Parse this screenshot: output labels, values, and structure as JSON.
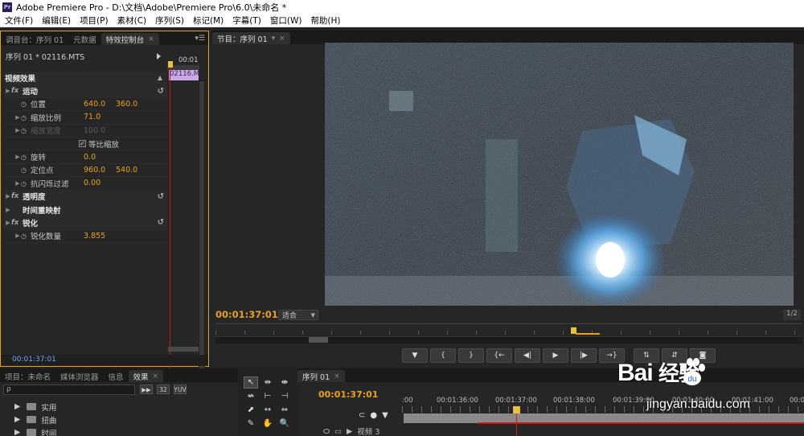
{
  "window": {
    "logo": "Pr",
    "title": "Adobe Premiere Pro - D:\\文档\\Adobe\\Premiere Pro\\6.0\\未命名 *"
  },
  "menu": [
    "文件(F)",
    "编辑(E)",
    "项目(P)",
    "素材(C)",
    "序列(S)",
    "标记(M)",
    "字幕(T)",
    "窗口(W)",
    "帮助(H)"
  ],
  "effect_controls": {
    "tabs": [
      {
        "label": "调音台：序列 01"
      },
      {
        "label": "元数据"
      },
      {
        "label": "特效控制台",
        "active": true
      }
    ],
    "sequence_label": "序列 01 * 02116.MTS",
    "timecode_top": "00:01",
    "clip_label": "02116.MTS",
    "section_title": "视频效果",
    "rows": [
      {
        "type": "section",
        "label": "运动",
        "fx": "fx",
        "reset": "↺"
      },
      {
        "label": "位置",
        "v1": "640.0",
        "v2": "360.0"
      },
      {
        "label": "缩放比例",
        "v1": "71.0",
        "tri": "▶"
      },
      {
        "label": "缩放宽度",
        "v1": "100.0",
        "dim": true,
        "tri": "▶"
      },
      {
        "label": "等比缩放",
        "checkbox": true
      },
      {
        "label": "旋转",
        "v1": "0.0",
        "tri": "▶"
      },
      {
        "label": "定位点",
        "v1": "960.0",
        "v2": "540.0"
      },
      {
        "label": "抗闪烁过滤",
        "v1": "0.00",
        "tri": "▶"
      },
      {
        "type": "section",
        "label": "透明度",
        "fx": "fx",
        "reset": "↺"
      },
      {
        "type": "section",
        "label": "时间重映射",
        "fx": ""
      },
      {
        "type": "section",
        "label": "锐化",
        "fx": "fx",
        "reset": "↺"
      },
      {
        "label": "锐化数量",
        "v1": "3.855",
        "tri": "▶"
      }
    ],
    "timecode_bottom": "00:01:37:01"
  },
  "program_monitor": {
    "tab": "节目：序列 01",
    "timecode": "00:01:37:01",
    "fit": "适合",
    "resolution": "1/2",
    "transport": [
      "▼",
      "{",
      "}",
      "{←",
      "◀|",
      "▶",
      "|▶",
      "→}"
    ],
    "extras": [
      "⇅",
      "⇵",
      "◙"
    ]
  },
  "project": {
    "tabs": [
      {
        "label": "项目：未命名"
      },
      {
        "label": "媒体浏览器"
      },
      {
        "label": "信息"
      },
      {
        "label": "效果",
        "active": true
      }
    ],
    "search_placeholder": "ρ",
    "search_buttons": [
      "▶▶",
      "32",
      "YUV"
    ],
    "bins": [
      "实用",
      "扭曲",
      "时间"
    ]
  },
  "tools": [
    "↖",
    "⇹",
    "⇼",
    "⇎",
    "⊢",
    "⊣",
    "⬈",
    "↔",
    "⇔",
    "✎",
    "✋",
    "🔍"
  ],
  "timeline": {
    "tab": "序列 01",
    "timecode": "00:01:37:01",
    "ruler": [
      ":00",
      "00:01:36:00",
      "00:01:37:00",
      "00:01:38:00",
      "00:01:39:00",
      "00:01:40:00",
      "00:01:41:00",
      "00:01:4"
    ],
    "track": "视频 3"
  },
  "watermark": {
    "brand": "Bai",
    "brand2": "经验",
    "url": "jingyan.baidu.com"
  }
}
